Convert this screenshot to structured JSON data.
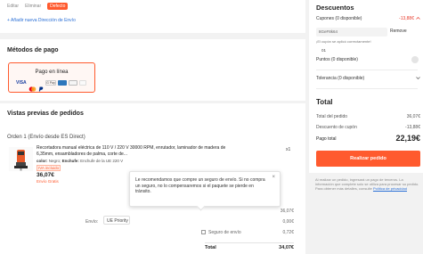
{
  "address": {
    "edit_label": "Editar",
    "delete_label": "Eliminar",
    "default_badge": "Defecto",
    "add_new_label": "+ Añadir nueva Dirección de Envío"
  },
  "payment": {
    "title": "Métodos de pago",
    "option_label": "Pago en línea",
    "card_icons": [
      "visa-icon",
      "mastercard-icon",
      "paypal-icon",
      "gpay-icon",
      "amex-icon",
      "card-icon",
      "card-icon-2"
    ]
  },
  "preview": {
    "title": "Vistas previas de pedidos",
    "order_title": "Orden 1 (Envío desde ES Direct)",
    "product": {
      "name": "Recortadora manual eléctrica de 110 V / 220 V 30000 RPM, enrutador, laminador de madera de 6,35mm, ensambladores de palma, corte de...",
      "color_label": "color:",
      "color_value": "Negro",
      "plug_label": "Enchufe:",
      "plug_value": "Enchufe de la UE 220 V",
      "iva_tag": "IVA incluido",
      "price": "36,07€",
      "free_shipping": "Envío Gratis",
      "quantity": "x1"
    },
    "tooltip": {
      "text": "Le recomendamos que compre un seguro de envío. Si no compra un seguro, no lo compensaremos si el paquete se pierde en tránsito.",
      "close": "×"
    },
    "envio_label": "Envío:",
    "envio_select": "UE Priority",
    "subtotal_value": "36,07€",
    "shipping_value": "0,00€",
    "insurance_label": "Seguro de envío",
    "insurance_value": "0,72€",
    "total_label": "Total",
    "total_value": "34,07€"
  },
  "summary": {
    "discounts_title": "Descuentos",
    "cupones_label": "Cupones (0 disponible)",
    "cupones_value": "-13,88€",
    "coupon_code_input": "8GeF8k64",
    "remove_label": "Remove",
    "coupon_note": "¡El cupón se aplicó correctamente!",
    "coupon_code_display": "01",
    "puntos_label": "Puntos (0 disponible)",
    "tolerancia_label": "Tolerancia (0 disponible)",
    "total_title": "Total",
    "total_pedido_label": "Total del pedido",
    "total_pedido_value": "36,07€",
    "descuento_label": "Descuento de cupón",
    "descuento_value": "-13,88€",
    "pago_total_label": "Pago total",
    "pago_total_value": "22,19€",
    "cta_label": "Realizar pedido",
    "legal_text": "Al realizar un pedido, ingresará un pago de terceros. La información que complete solo se utiliza para procesar su pedido. Para obtener más detalles, consulte",
    "legal_link": "Política de privacidad"
  },
  "colors": {
    "accent": "#ff5a2e",
    "discount": "#e83a2b",
    "link": "#2a6fd6"
  }
}
